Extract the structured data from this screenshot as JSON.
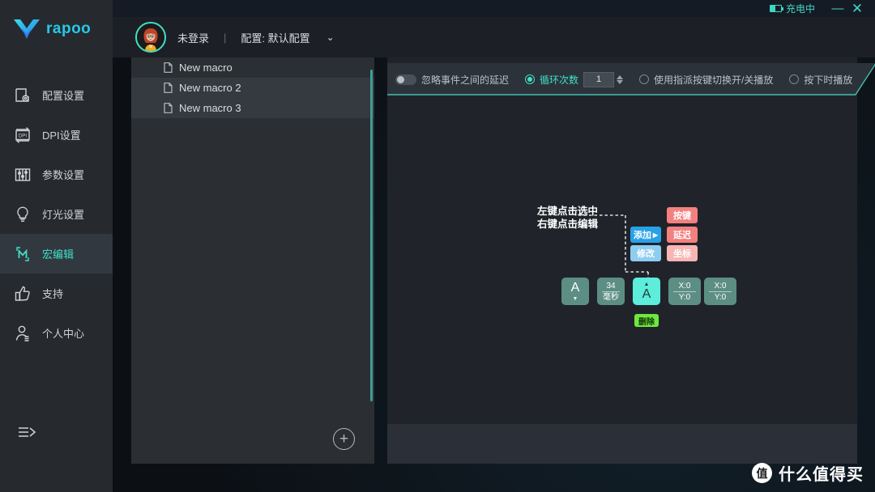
{
  "titlebar": {
    "battery_icon": "battery-charging-icon",
    "charge_label": "充电中",
    "minimize_label": "—",
    "close_label": "✕",
    "accent_color": "#3fe0c8"
  },
  "sidebar": {
    "brand": "rapoo",
    "logo_icon": "rapoo-v-logo",
    "items": [
      {
        "label": "配置设置",
        "icon": "config-gear-icon",
        "active": false
      },
      {
        "label": "DPI设置",
        "icon": "dpi-icon",
        "active": false
      },
      {
        "label": "参数设置",
        "icon": "sliders-icon",
        "active": false
      },
      {
        "label": "灯光设置",
        "icon": "lightbulb-icon",
        "active": false
      },
      {
        "label": "宏编辑",
        "icon": "macro-m-icon",
        "active": true
      },
      {
        "label": "支持",
        "icon": "thumbs-up-icon",
        "active": false
      },
      {
        "label": "个人中心",
        "icon": "user-profile-icon",
        "active": false
      }
    ],
    "collapse_icon": "collapse-menu-icon"
  },
  "userbar": {
    "avatar_icon": "user-avatar",
    "login_status": "未登录",
    "separator": "|",
    "profile_label": "配置: 默认配置",
    "chevron": "⌄"
  },
  "macro_list": {
    "items": [
      {
        "name": "New macro",
        "icon": "document-icon"
      },
      {
        "name": "New macro 2",
        "icon": "document-icon"
      },
      {
        "name": "New macro 3",
        "icon": "document-icon"
      }
    ],
    "add_button_label": "+",
    "scrollbar_color": "#3c9e96"
  },
  "toolbar": {
    "ignore_delay_label": "忽略事件之间的延迟",
    "ignore_delay_on": false,
    "loop_count_label": "循环次数",
    "loop_count_selected": true,
    "loop_count_value": "1",
    "toggle_play_label": "使用指派按键切换开/关播放",
    "toggle_play_selected": false,
    "press_play_label": "按下时播放",
    "press_play_selected": false,
    "accent_color": "#3fe0c8"
  },
  "diagram": {
    "hint_line1": "左键点击选中",
    "hint_line2": "右键点击编辑",
    "context_menu": {
      "add_label": "添加",
      "add_arrow": "▶",
      "modify_label": "修改",
      "key_label": "按键",
      "delay_label": "延迟",
      "coord_label": "坐标"
    },
    "blocks": [
      {
        "type": "key",
        "main": "A",
        "caret": "▼",
        "selected": false
      },
      {
        "type": "delay",
        "top": "34",
        "bottom": "毫秒",
        "selected": false
      },
      {
        "type": "key",
        "main": "A",
        "caret": "▲",
        "selected": true
      },
      {
        "type": "coord",
        "top": "X:0",
        "bottom": "Y:0",
        "selected": false
      },
      {
        "type": "coord",
        "top": "X:0",
        "bottom": "Y:0",
        "selected": false
      }
    ],
    "delete_label": "删除",
    "colors": {
      "block": "#5d8e84",
      "block_selected": "#5ceddb",
      "add": "#27a2e8",
      "modify": "#8ecdf2",
      "key": "#f4807f",
      "delay": "#f4807f",
      "coord": "#f7b6b5",
      "delete": "#6ee83f"
    }
  },
  "watermark": {
    "badge": "值",
    "text": "什么值得买"
  }
}
